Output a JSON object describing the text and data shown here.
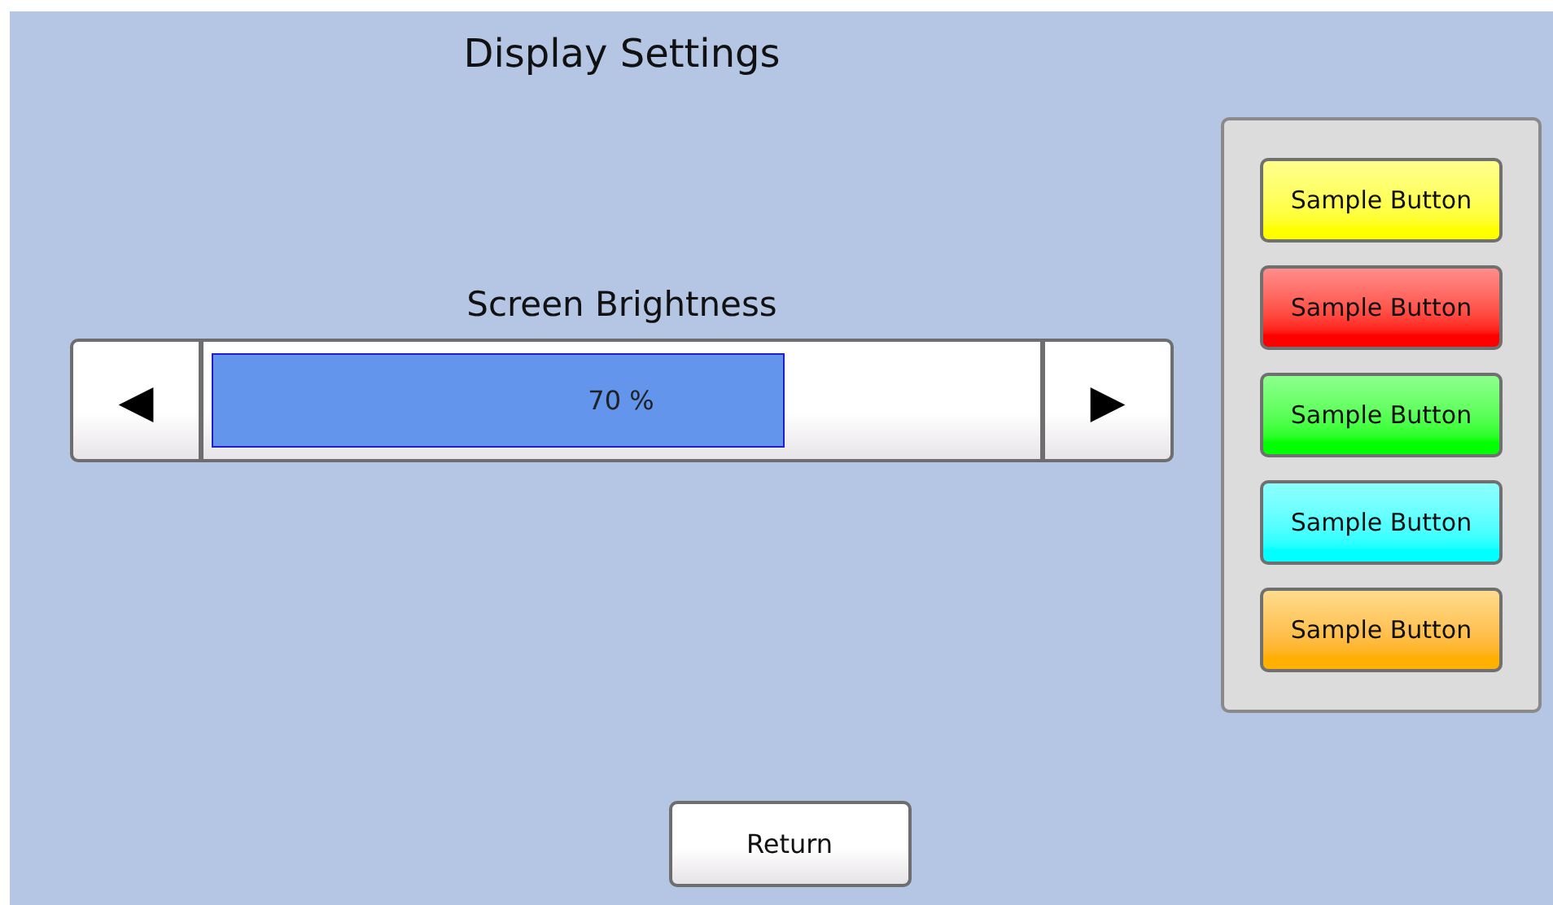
{
  "title": "Display Settings",
  "slider": {
    "label": "Screen Brightness",
    "level": 0.7,
    "reading": "70 %",
    "decrease": "◀",
    "increase": "▶"
  },
  "sample_buttons": [
    {
      "label": "Sample Button",
      "color": "#ffff00"
    },
    {
      "label": "Sample Button",
      "color": "#ff0000"
    },
    {
      "label": "Sample Button",
      "color": "#00ff00"
    },
    {
      "label": "Sample Button",
      "color": "#00ffff"
    },
    {
      "label": "Sample Button",
      "color": "#ffb000"
    }
  ],
  "return_button": "Return"
}
